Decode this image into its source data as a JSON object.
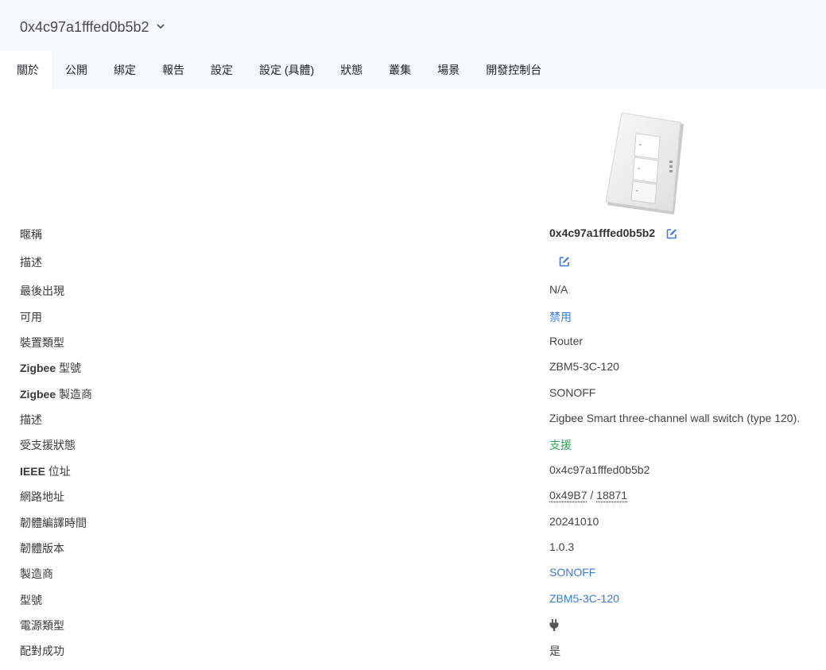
{
  "header": {
    "device_title": "0x4c97a1fffed0b5b2"
  },
  "tabs": [
    "關於",
    "公開",
    "綁定",
    "報告",
    "設定",
    "設定 (具體)",
    "狀態",
    "叢集",
    "場景",
    "開發控制台"
  ],
  "details": {
    "friendly_name": {
      "label": "暱稱",
      "value": "0x4c97a1fffed0b5b2"
    },
    "description_edit": {
      "label": "描述"
    },
    "last_seen": {
      "label": "最後出現",
      "value": "N/A"
    },
    "availability": {
      "label": "可用",
      "value": "禁用"
    },
    "device_type": {
      "label": "裝置類型",
      "value": "Router"
    },
    "zigbee_model": {
      "label_bold": "Zigbee",
      "label_rest": " 型號",
      "value": "ZBM5-3C-120"
    },
    "zigbee_manufacturer": {
      "label_bold": "Zigbee",
      "label_rest": " 製造商",
      "value": "SONOFF"
    },
    "description": {
      "label": "描述",
      "value": "Zigbee Smart three-channel wall switch (type 120)."
    },
    "support_status": {
      "label": "受支援狀態",
      "value": "支援"
    },
    "ieee_address": {
      "label_bold": "IEEE",
      "label_rest": " 位址",
      "value": "0x4c97a1fffed0b5b2"
    },
    "network_address": {
      "label": "網路地址",
      "hex": "0x49B7",
      "separator": " / ",
      "dec": "18871"
    },
    "firmware_build_date": {
      "label": "韌體編譯時間",
      "value": "20241010"
    },
    "firmware_version": {
      "label": "韌體版本",
      "value": "1.0.3"
    },
    "manufacturer": {
      "label": "製造商",
      "value": "SONOFF"
    },
    "model": {
      "label": "型號",
      "value": "ZBM5-3C-120"
    },
    "power_source": {
      "label": "電源類型",
      "icon": "plug-icon"
    },
    "interview_completed": {
      "label": "配對成功",
      "value": "是"
    }
  },
  "colors": {
    "link": "#3b7dd8",
    "success": "#2ea55a",
    "header_bg": "#f7f8fb"
  }
}
